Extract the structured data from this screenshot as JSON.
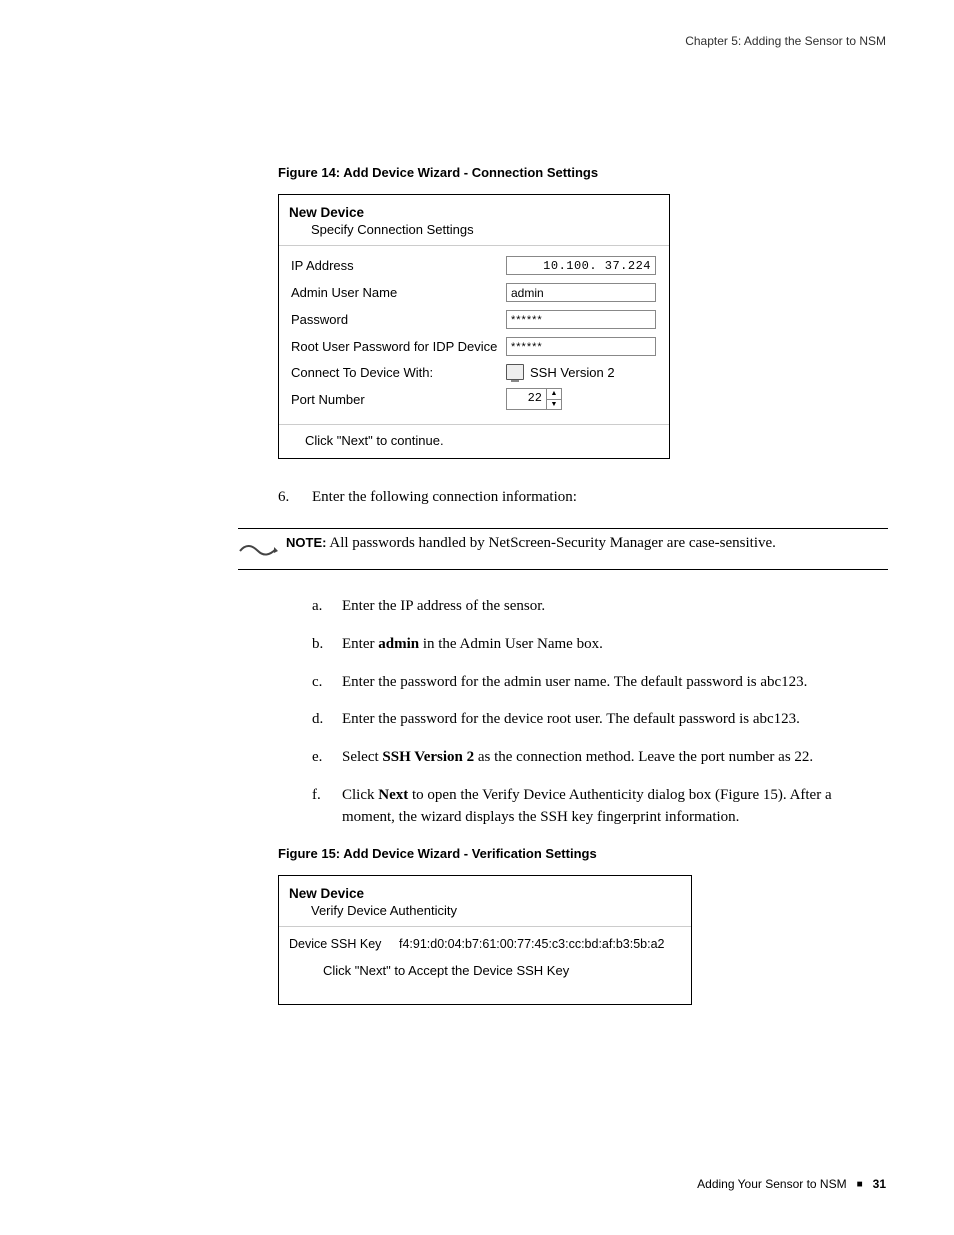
{
  "header": {
    "chapter": "Chapter 5: Adding the Sensor to NSM"
  },
  "figure14": {
    "caption": "Figure 14:  Add Device Wizard - Connection Settings",
    "title": "New Device",
    "subtitle": "Specify Connection Settings",
    "rows": {
      "ip_label": "IP Address",
      "ip_value": "10.100. 37.224",
      "user_label": "Admin User Name",
      "user_value": "admin",
      "pwd_label": "Password",
      "pwd_value": "******",
      "root_label": "Root User Password for IDP Device",
      "root_value": "******",
      "connect_label": "Connect To Device With:",
      "connect_value": "SSH Version 2",
      "port_label": "Port Number",
      "port_value": "22"
    },
    "footer": "Click \"Next\" to continue."
  },
  "step6": {
    "marker": "6.",
    "text": "Enter the following connection information:"
  },
  "note": {
    "label": "NOTE:",
    "text": "All passwords handled by NetScreen-Security Manager are case-sensitive."
  },
  "substeps": {
    "a": {
      "marker": "a.",
      "text_pre": "Enter the IP address of the sensor."
    },
    "b": {
      "marker": "b.",
      "pre": "Enter ",
      "bold": "admin",
      "post": " in the Admin User Name box."
    },
    "c": {
      "marker": "c.",
      "text": "Enter the password for the admin user name. The default password is abc123."
    },
    "d": {
      "marker": "d.",
      "text": "Enter the password for the device root user. The default password is abc123."
    },
    "e": {
      "marker": "e.",
      "pre": "Select ",
      "bold": "SSH Version 2",
      "post": " as the connection method. Leave the port number as 22."
    },
    "f": {
      "marker": "f.",
      "pre": "Click ",
      "bold": "Next",
      "post": " to open the Verify Device Authenticity dialog box (Figure 15). After a moment, the wizard displays the SSH key fingerprint information."
    }
  },
  "figure15": {
    "caption": "Figure 15:  Add Device Wizard - Verification Settings",
    "title": "New Device",
    "subtitle": "Verify Device Authenticity",
    "ssh_label": "Device SSH Key",
    "ssh_value": "f4:91:d0:04:b7:61:00:77:45:c3:cc:bd:af:b3:5b:a2",
    "footer": "Click \"Next\" to Accept the Device SSH Key"
  },
  "footer": {
    "section": "Adding Your Sensor to NSM",
    "page": "31"
  }
}
